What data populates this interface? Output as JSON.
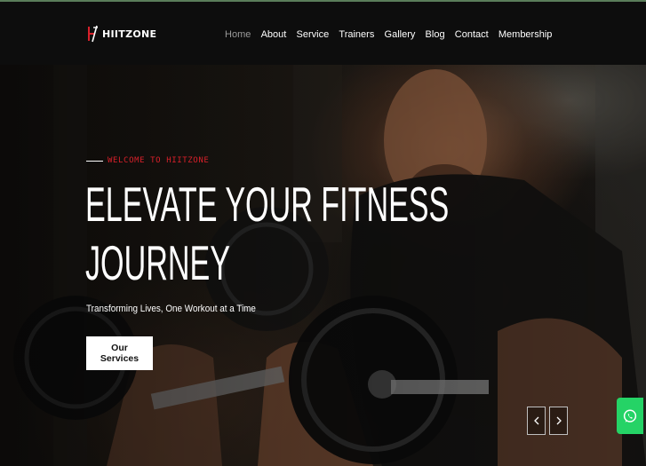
{
  "brand": {
    "name": "HIITZONE"
  },
  "nav": {
    "items": [
      {
        "label": "Home",
        "active": true
      },
      {
        "label": "About",
        "active": false
      },
      {
        "label": "Service",
        "active": false
      },
      {
        "label": "Trainers",
        "active": false
      },
      {
        "label": "Gallery",
        "active": false
      },
      {
        "label": "Blog",
        "active": false
      },
      {
        "label": "Contact",
        "active": false
      },
      {
        "label": "Membership",
        "active": false
      }
    ]
  },
  "hero": {
    "welcome": "WELCOME TO HIITZONE",
    "title_line1": "ELEVATE YOUR FITNESS",
    "title_line2": "JOURNEY",
    "subtitle": "Transforming Lives, One Workout at a Time",
    "cta_label": "Our Services",
    "prev_icon": "chevron-left-icon",
    "next_icon": "chevron-right-icon"
  },
  "floating": {
    "whatsapp_icon": "whatsapp-icon"
  },
  "colors": {
    "accent": "#d8202a",
    "whatsapp": "#25d366",
    "navbar_bg": "#0d0d0d",
    "active_nav": "#9a9a9a"
  }
}
